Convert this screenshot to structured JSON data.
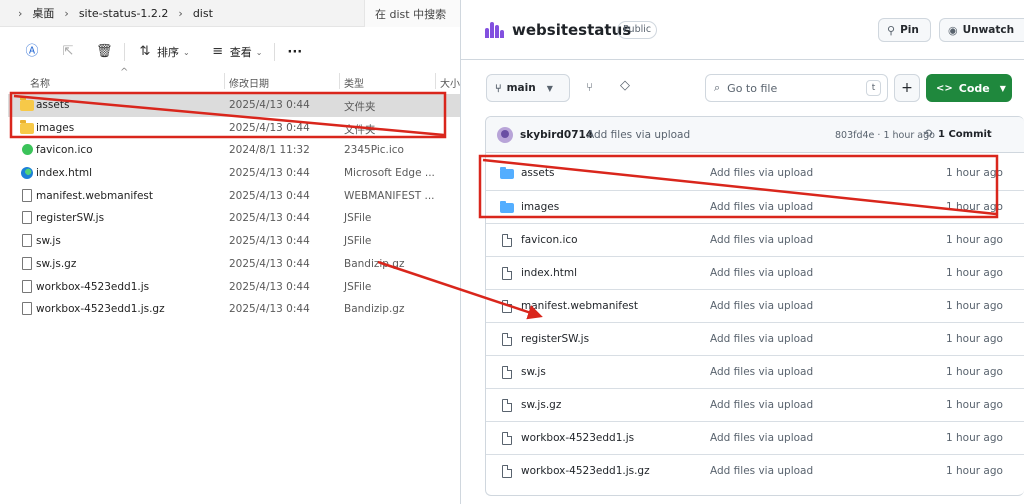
{
  "explorer": {
    "breadcrumbs": [
      "桌面",
      "site-status-1.2.2",
      "dist"
    ],
    "search_placeholder": "在 dist 中搜索",
    "toolbar": {
      "sort_label": "排序",
      "view_label": "查看",
      "more_label": "···"
    },
    "columns": {
      "name": "名称",
      "date": "修改日期",
      "type": "类型",
      "size": "大小"
    },
    "files": [
      {
        "name": "assets",
        "date": "2025/4/13 0:44",
        "type": "文件夹",
        "icon": "folder-icon",
        "selected": true
      },
      {
        "name": "images",
        "date": "2025/4/13 0:44",
        "type": "文件夹",
        "icon": "folder-icon"
      },
      {
        "name": "favicon.ico",
        "date": "2024/8/1 11:32",
        "type": "2345Pic.ico",
        "icon": "image-file-icon"
      },
      {
        "name": "index.html",
        "date": "2025/4/13 0:44",
        "type": "Microsoft Edge ...",
        "icon": "edge-html-icon"
      },
      {
        "name": "manifest.webmanifest",
        "date": "2025/4/13 0:44",
        "type": "WEBMANIFEST ...",
        "icon": "file-icon"
      },
      {
        "name": "registerSW.js",
        "date": "2025/4/13 0:44",
        "type": "JSFile",
        "icon": "file-icon"
      },
      {
        "name": "sw.js",
        "date": "2025/4/13 0:44",
        "type": "JSFile",
        "icon": "file-icon"
      },
      {
        "name": "sw.js.gz",
        "date": "2025/4/13 0:44",
        "type": "Bandizip.gz",
        "icon": "file-icon"
      },
      {
        "name": "workbox-4523edd1.js",
        "date": "2025/4/13 0:44",
        "type": "JSFile",
        "icon": "file-icon"
      },
      {
        "name": "workbox-4523edd1.js.gz",
        "date": "2025/4/13 0:44",
        "type": "Bandizip.gz",
        "icon": "file-icon"
      }
    ]
  },
  "github": {
    "repo_name": "websitestatus",
    "visibility": "Public",
    "pin_label": "Pin",
    "unwatch_label": "Unwatch",
    "branch": "main",
    "search_placeholder": "Go to file",
    "search_shortcut": "t",
    "add_label": "+",
    "code_label": "Code",
    "accent": "#1f883d",
    "commit": {
      "user": "skybird0714",
      "message": "Add files via upload",
      "hash_time": "803fd4e · 1 hour ago",
      "commits": "1 Commit"
    },
    "files": [
      {
        "name": "assets",
        "message": "Add files via upload",
        "time": "1 hour ago",
        "kind": "folder"
      },
      {
        "name": "images",
        "message": "Add files via upload",
        "time": "1 hour ago",
        "kind": "folder"
      },
      {
        "name": "favicon.ico",
        "message": "Add files via upload",
        "time": "1 hour ago",
        "kind": "file"
      },
      {
        "name": "index.html",
        "message": "Add files via upload",
        "time": "1 hour ago",
        "kind": "file"
      },
      {
        "name": "manifest.webmanifest",
        "message": "Add files via upload",
        "time": "1 hour ago",
        "kind": "file"
      },
      {
        "name": "registerSW.js",
        "message": "Add files via upload",
        "time": "1 hour ago",
        "kind": "file"
      },
      {
        "name": "sw.js",
        "message": "Add files via upload",
        "time": "1 hour ago",
        "kind": "file"
      },
      {
        "name": "sw.js.gz",
        "message": "Add files via upload",
        "time": "1 hour ago",
        "kind": "file"
      },
      {
        "name": "workbox-4523edd1.js",
        "message": "Add files via upload",
        "time": "1 hour ago",
        "kind": "file"
      },
      {
        "name": "workbox-4523edd1.js.gz",
        "message": "Add files via upload",
        "time": "1 hour ago",
        "kind": "file"
      }
    ]
  },
  "annotation_color": "#d9261c"
}
